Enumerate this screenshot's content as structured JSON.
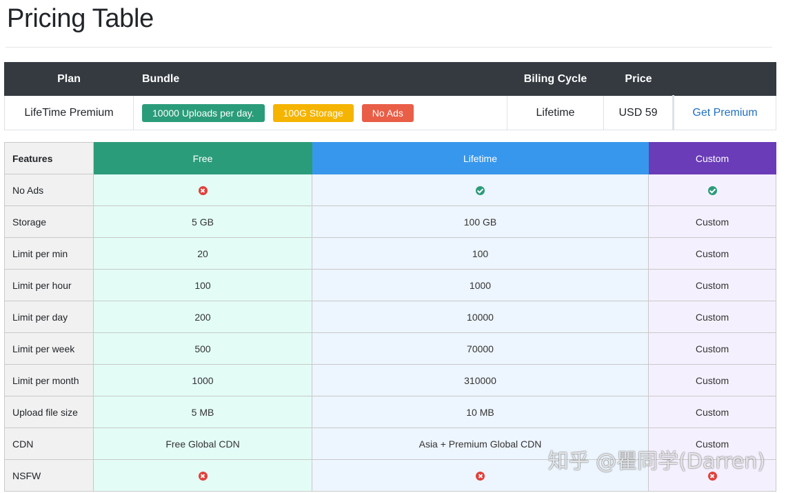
{
  "page": {
    "title": "Pricing Table"
  },
  "plan_table": {
    "headers": {
      "plan": "Plan",
      "bundle": "Bundle",
      "cycle": "Biling Cycle",
      "price": "Price"
    },
    "row": {
      "plan": "LifeTime Premium",
      "badges": [
        {
          "label": "10000 Uploads per day.",
          "color": "#2b9c79"
        },
        {
          "label": "100G Storage",
          "color": "#f5b400"
        },
        {
          "label": "No Ads",
          "color": "#e95e47"
        }
      ],
      "cycle": "Lifetime",
      "price": "USD 59",
      "action": "Get Premium"
    }
  },
  "features_table": {
    "headers": {
      "features": "Features",
      "free": "Free",
      "lifetime": "Lifetime",
      "custom": "Custom"
    },
    "colors": {
      "free": "#2b9c79",
      "lifetime": "#3797ec",
      "custom": "#6a3cb8"
    },
    "rows": [
      {
        "name": "No Ads",
        "free": "x-circle-icon",
        "lifetime": "check-circle-icon",
        "custom": "check-circle-icon"
      },
      {
        "name": "Storage",
        "free": "5 GB",
        "lifetime": "100 GB",
        "custom": "Custom"
      },
      {
        "name": "Limit per min",
        "free": "20",
        "lifetime": "100",
        "custom": "Custom"
      },
      {
        "name": "Limit per hour",
        "free": "100",
        "lifetime": "1000",
        "custom": "Custom"
      },
      {
        "name": "Limit per day",
        "free": "200",
        "lifetime": "10000",
        "custom": "Custom"
      },
      {
        "name": "Limit per week",
        "free": "500",
        "lifetime": "70000",
        "custom": "Custom"
      },
      {
        "name": "Limit per month",
        "free": "1000",
        "lifetime": "310000",
        "custom": "Custom"
      },
      {
        "name": "Upload file size",
        "free": "5 MB",
        "lifetime": "10 MB",
        "custom": "Custom"
      },
      {
        "name": "CDN",
        "free": "Free Global CDN",
        "lifetime": "Asia + Premium Global CDN",
        "custom": "Custom"
      },
      {
        "name": "NSFW",
        "free": "x-circle-icon",
        "lifetime": "x-circle-icon",
        "custom": "x-circle-icon"
      }
    ]
  },
  "watermark": "知乎 @瞿同学(Darren)"
}
